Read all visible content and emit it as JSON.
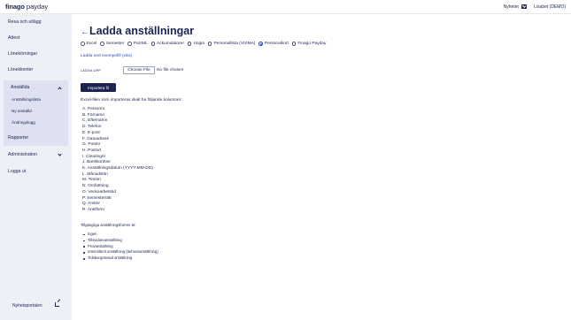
{
  "header": {
    "logo_main": "finago",
    "logo_sub": "payday",
    "news_label": "Nyheter",
    "news_icon": "mail-icon",
    "user_label": "Lisabet (DEMO)"
  },
  "sidebar": {
    "items": [
      {
        "label": "Resa och utlägg"
      },
      {
        "label": "Attest"
      },
      {
        "label": "Lönekörningar"
      },
      {
        "label": "Löneklienter"
      }
    ],
    "expanded_group": {
      "label": "Anställda",
      "sub_items": [
        {
          "label": "Anställningslista"
        },
        {
          "label": "Ny anställd"
        },
        {
          "label": "Ändringslogg"
        }
      ]
    },
    "items_after": [
      {
        "label": "Rapporter"
      },
      {
        "label": "Administration"
      },
      {
        "label": "Logga ut"
      }
    ],
    "footer_link": "Nyhetsportalen"
  },
  "main": {
    "title": "Ladda anställningar",
    "formats": [
      {
        "label": "Excel",
        "selected": false
      },
      {
        "label": "Semester",
        "selected": false
      },
      {
        "label": "PaXML",
        "selected": false
      },
      {
        "label": "Ackumulatorer",
        "selected": false
      },
      {
        "label": "Hogia",
        "selected": false
      },
      {
        "label": "Personallista (VISMA)",
        "selected": false
      },
      {
        "label": "Personalkort",
        "selected": true
      },
      {
        "label": "Finago Payday",
        "selected": false
      }
    ],
    "example_link": "Ladda ned exempelfil (xlsx)",
    "upload_label": "LADDA UPP",
    "choose_file_label": "Choose File",
    "no_file_label": "No file chosen",
    "import_button": "Importera fil",
    "intro": "Excel-filen som importeras skall ha följande kolumner:",
    "columns": [
      "A. Personnr",
      "B. Förnamn",
      "C. Efternamn",
      "D. Telefon",
      "E. E-post",
      "F. Gatuadress",
      "G. Postnr",
      "H. Postort",
      "I. Clearingnr",
      "J. Bankkontonr",
      "K. Anställningsdatum (YYYY-MM-DD)",
      "L. Månadslön",
      "M. Timlön",
      "N. Omfattning",
      "O. Veckoarbetstid",
      "P. Semesterrätt",
      "Q. Anstnr",
      "R. Anstform"
    ],
    "forms_title": "Tillgängliga anställningsformer är:",
    "forms": [
      "Ingen",
      "Tillsvidareanställning",
      "Provanställning",
      "Intermittent anställning (behovsanställning)",
      "Tidsbergränsad anställning"
    ]
  }
}
